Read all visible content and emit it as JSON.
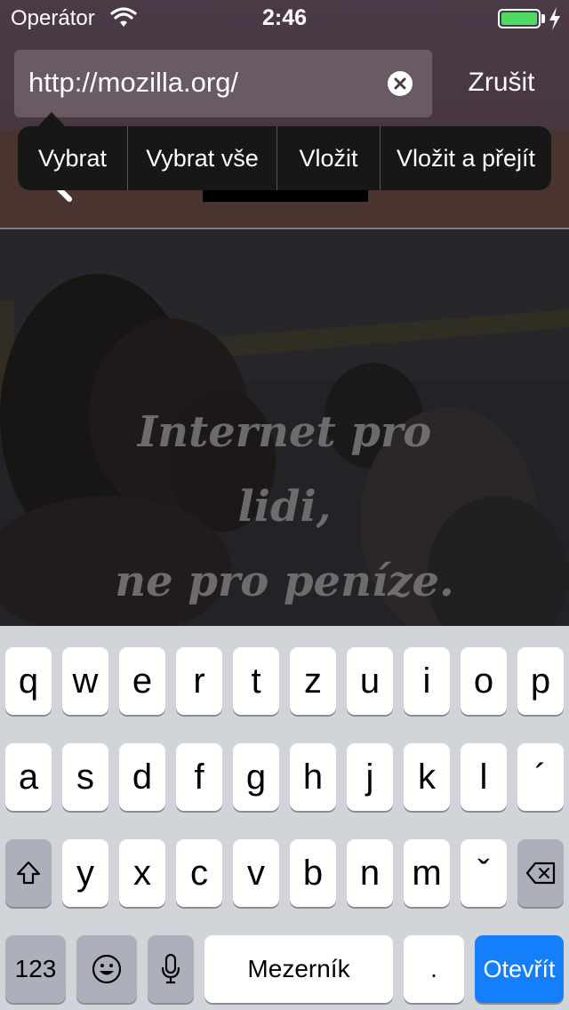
{
  "status_bar": {
    "carrier": "Operátor",
    "time": "2:46",
    "battery_level": 1.0,
    "battery_color": "#4cd964"
  },
  "address_bar": {
    "url": "http://mozilla.org/",
    "clear_icon": "clear-circle-icon",
    "cancel_label": "Zrušit"
  },
  "edit_menu": {
    "items": [
      "Vybrat",
      "Vybrat vše",
      "Vložit",
      "Vložit a přejít"
    ]
  },
  "page": {
    "hero_lines": [
      "Internet pro",
      "lidi,",
      "ne pro peníze."
    ]
  },
  "keyboard": {
    "row1": [
      "q",
      "w",
      "e",
      "r",
      "t",
      "z",
      "u",
      "i",
      "o",
      "p"
    ],
    "row2": [
      "a",
      "s",
      "d",
      "f",
      "g",
      "h",
      "j",
      "k",
      "l",
      "´"
    ],
    "row3": [
      "y",
      "x",
      "c",
      "v",
      "b",
      "n",
      "m",
      "ˇ"
    ],
    "numbers_label": "123",
    "space_label": "Mezerník",
    "period_label": ".",
    "open_label": "Otevřít",
    "accent_color": "#147efb"
  }
}
